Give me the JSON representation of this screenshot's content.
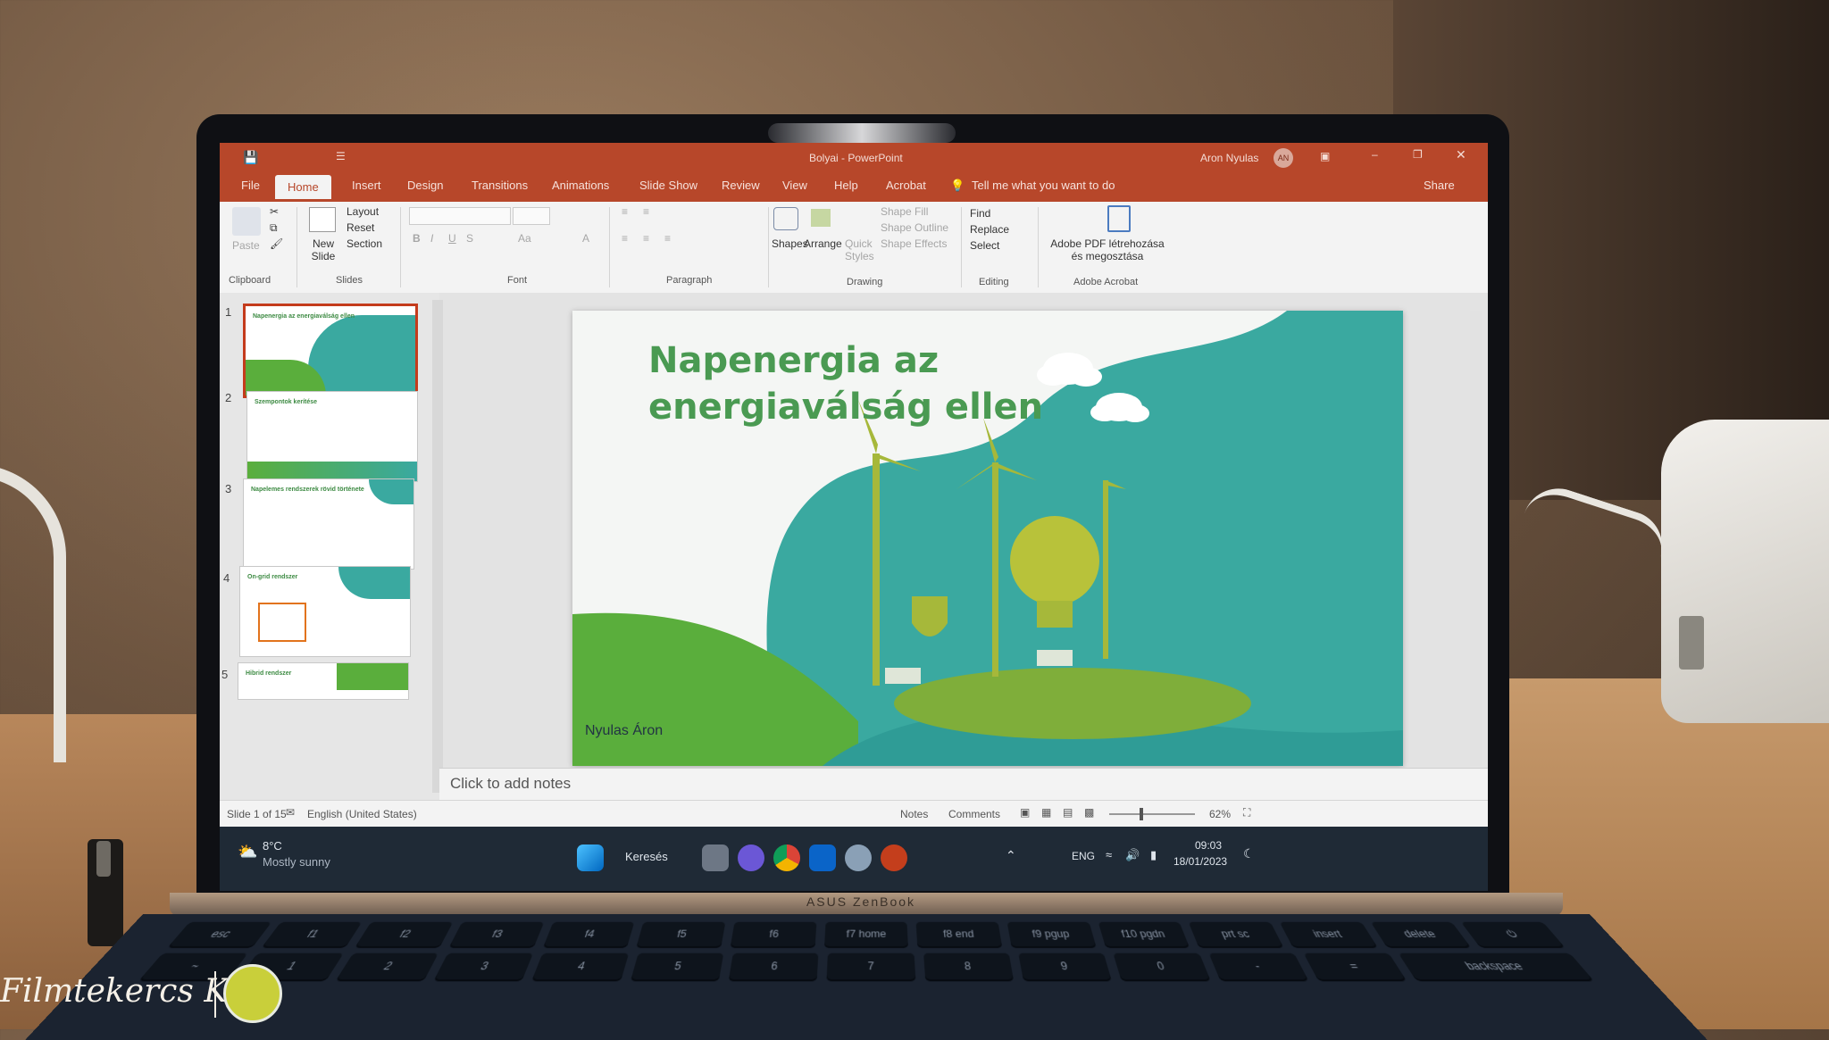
{
  "app": {
    "title": "Bolyai - PowerPoint",
    "user": "Aron Nyulas",
    "user_initials": "AN"
  },
  "tabs": [
    "File",
    "Home",
    "Insert",
    "Design",
    "Transitions",
    "Animations",
    "Slide Show",
    "Review",
    "View",
    "Help",
    "Acrobat"
  ],
  "search_tell": "Tell me what you want to do",
  "share": "Share",
  "ribbon": {
    "clipboard": {
      "label": "Clipboard",
      "paste": "Paste"
    },
    "slides": {
      "label": "Slides",
      "new_slide": "New Slide",
      "layout": "Layout",
      "reset": "Reset",
      "section": "Section"
    },
    "font": {
      "label": "Font"
    },
    "paragraph": {
      "label": "Paragraph"
    },
    "drawing": {
      "label": "Drawing",
      "shapes": "Shapes",
      "arrange": "Arrange",
      "quick_styles": "Quick Styles",
      "shape_fill": "Shape Fill",
      "shape_outline": "Shape Outline",
      "shape_effects": "Shape Effects"
    },
    "editing": {
      "label": "Editing",
      "find": "Find",
      "replace": "Replace",
      "select": "Select"
    },
    "acrobat": {
      "label": "Adobe Acrobat",
      "btn": "Adobe PDF létrehozása és megosztása"
    }
  },
  "thumbnails": [
    {
      "num": "1",
      "title": "Napenergia az energiaválság ellen"
    },
    {
      "num": "2",
      "title": "Szempontok kerítése"
    },
    {
      "num": "3",
      "title": "Napelemes rendszerek rövid története"
    },
    {
      "num": "4",
      "title": "On-grid rendszer"
    },
    {
      "num": "5",
      "title": "Hibrid rendszer"
    }
  ],
  "slide": {
    "title_line1": "Napenergia az",
    "title_line2": "energiaválság ellen",
    "author": "Nyulas Áron"
  },
  "notes_placeholder": "Click to add notes",
  "status": {
    "slide": "Slide 1 of 15",
    "language": "English (United States)",
    "notes": "Notes",
    "comments": "Comments",
    "zoom": "62%"
  },
  "taskbar": {
    "weather_temp": "8°C",
    "weather_text": "Mostly sunny",
    "search": "Keresés",
    "lang": "ENG",
    "time": "09:03",
    "date": "18/01/2023"
  },
  "laptop_brand": "ASUS ZenBook",
  "keys": [
    "esc",
    "f1",
    "f2",
    "f3",
    "f4",
    "f5",
    "f6",
    "f7 home",
    "f8 end",
    "f9 pgup",
    "f10 pgdn",
    "prt sc",
    "insert",
    "delete",
    "⏻"
  ],
  "numkeys": [
    "~",
    "1",
    "2",
    "3",
    "4",
    "5",
    "6",
    "7",
    "8",
    "9",
    "0",
    "-",
    "=",
    "backspace"
  ],
  "watermark": {
    "text": "Filmtekercs Klub"
  },
  "colors": {
    "ppt_red": "#b7472a",
    "slide_green": "#4a9a52",
    "teal": "#3aa9a0"
  }
}
